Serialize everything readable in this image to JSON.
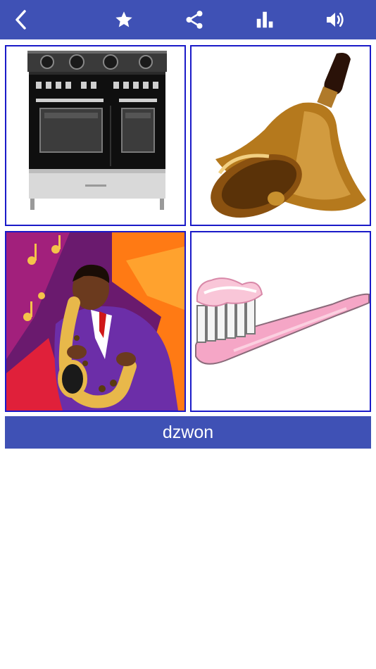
{
  "toolbar": {
    "color": "#3f51b5",
    "icons": [
      "back-icon",
      "star-icon",
      "share-icon",
      "bar-chart-icon",
      "volume-icon"
    ]
  },
  "grid": {
    "border_color": "#1a1ac8",
    "tiles": [
      {
        "picture": "stove"
      },
      {
        "picture": "bell"
      },
      {
        "picture": "saxophone-player"
      },
      {
        "picture": "toothbrush"
      }
    ]
  },
  "answer": {
    "word": "dzwon",
    "color": "#3f51b5"
  }
}
